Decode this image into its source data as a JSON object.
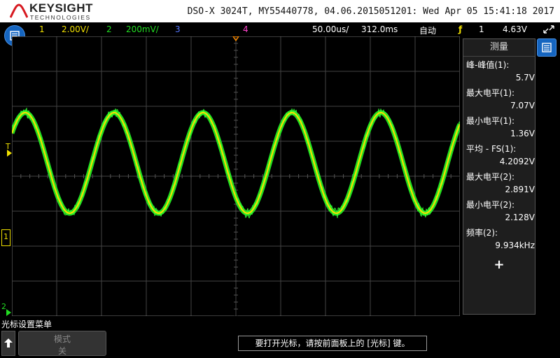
{
  "header": {
    "brand": "KEYSIGHT",
    "brand_sub": "TECHNOLOGIES",
    "title": "DSO-X 3024T, MY55440778, 04.06.2015051201: Wed Apr 05 15:41:18 2017"
  },
  "status": {
    "ch1_num": "1",
    "ch1_scale": "2.00V/",
    "ch2_num": "2",
    "ch2_scale": "200mV/",
    "ch3_num": "3",
    "ch4_num": "4",
    "timebase": "50.00us/",
    "delay": "312.0ms",
    "trigger_mode": "自动",
    "trigger_icon": "ƒ",
    "trigger_source": "1",
    "trigger_level": "4.63V",
    "colors": {
      "ch1": "#f0e000",
      "ch2": "#22dd22",
      "ch3": "#5577ff",
      "ch4": "#ff44cc"
    }
  },
  "markers": {
    "trigger_T": "T",
    "ch1_marker": "1",
    "ch2_marker": "2"
  },
  "panel": {
    "title": "测量",
    "measurements": [
      {
        "label": "峰-峰值(1):",
        "value": "5.7V",
        "label_color": "#ffffff"
      },
      {
        "label": "最大电平(1):",
        "value": "7.07V"
      },
      {
        "label": "最小电平(1):",
        "value": "1.36V"
      },
      {
        "label": "平均 - FS(1):",
        "value": "4.2092V"
      },
      {
        "label": "最大电平(2):",
        "value": "2.891V"
      },
      {
        "label": "最小电平(2):",
        "value": "2.128V"
      },
      {
        "label": "频率(2):",
        "value": "9.934kHz"
      }
    ],
    "add": "+"
  },
  "bottom": {
    "menu_title": "光标设置菜单",
    "softkey_label": "模式",
    "softkey_value": "关",
    "hint": "要打开光标，请按前面板上的 [光标] 键。"
  }
}
